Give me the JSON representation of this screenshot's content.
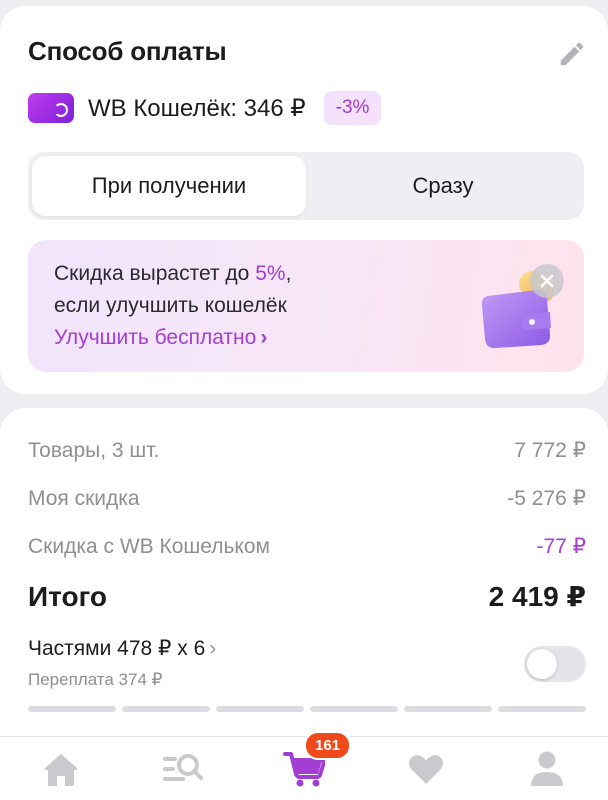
{
  "payment": {
    "title": "Способ оплаты",
    "wallet_label": "WB Кошелёк: 346 ₽",
    "discount_badge": "-3%",
    "tabs": [
      {
        "label": "При получении",
        "selected": true
      },
      {
        "label": "Сразу",
        "selected": false
      }
    ],
    "promo": {
      "line1_prefix": "Скидка вырастет до ",
      "line1_accent": "5%",
      "line1_suffix": ",",
      "line2": "если улучшить кошелёк",
      "link": "Улучшить бесплатно",
      "link_chevron": "›"
    }
  },
  "summary": {
    "rows": [
      {
        "label": "Товары, 3 шт.",
        "value": "7 772 ₽"
      },
      {
        "label": "Моя скидка",
        "value": "-5 276 ₽"
      },
      {
        "label": "Скидка с WB Кошельком",
        "value": "-77 ₽"
      }
    ],
    "total_label": "Итого",
    "total_value": "2 419 ₽",
    "installments": {
      "label": "Частями 478 ₽ х 6",
      "chevron": "›",
      "overpay": "Переплата 374 ₽",
      "enabled": false
    }
  },
  "nav": {
    "items": [
      {
        "icon": "home-icon"
      },
      {
        "icon": "catalog-search-icon"
      },
      {
        "icon": "cart-icon",
        "badge": "161",
        "active": true
      },
      {
        "icon": "heart-icon"
      },
      {
        "icon": "profile-icon"
      }
    ]
  },
  "colors": {
    "accent": "#a23fd2",
    "badge": "#f04a1a",
    "background": "#efeff3"
  }
}
